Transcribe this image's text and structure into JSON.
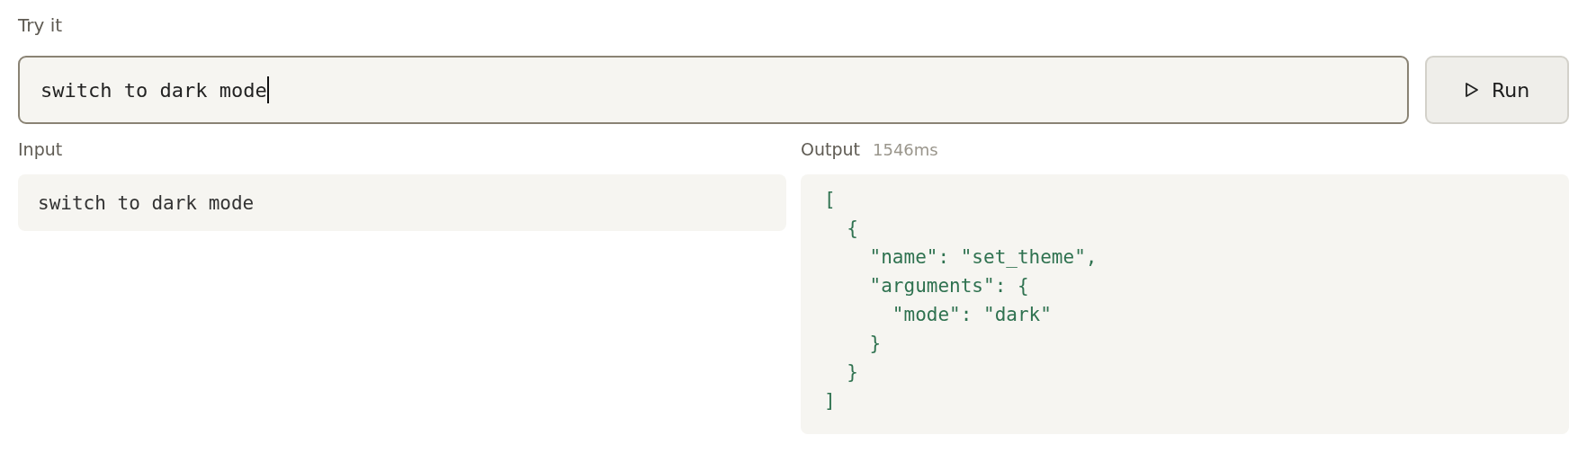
{
  "heading": "Try it",
  "prompt_field": {
    "value": "switch to dark mode",
    "focused": true
  },
  "run_button": {
    "label": "Run"
  },
  "input_panel": {
    "label": "Input",
    "text": "switch to dark mode"
  },
  "output_panel": {
    "label": "Output",
    "duration": "1546ms",
    "code": "[\n  {\n    \"name\": \"set_theme\",\n    \"arguments\": {\n      \"mode\": \"dark\"\n    }\n  }\n]"
  }
}
